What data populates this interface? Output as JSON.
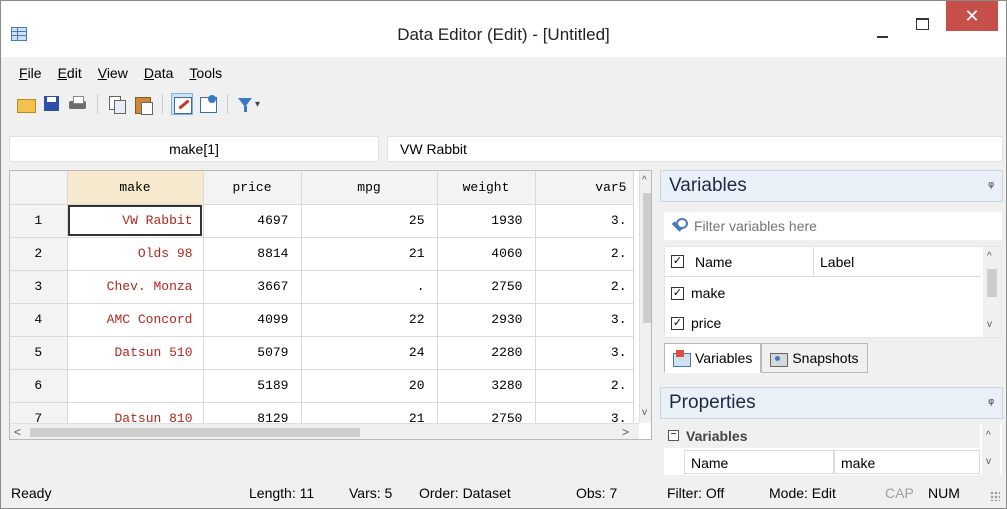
{
  "window": {
    "title": "Data Editor (Edit) - [Untitled]",
    "close_glyph": "✕"
  },
  "menu": [
    {
      "label": "File",
      "accel": "F",
      "rest": "ile"
    },
    {
      "label": "Edit",
      "accel": "E",
      "rest": "dit"
    },
    {
      "label": "View",
      "accel": "V",
      "rest": "iew"
    },
    {
      "label": "Data",
      "accel": "D",
      "rest": "ata"
    },
    {
      "label": "Tools",
      "accel": "T",
      "rest": "ools"
    }
  ],
  "toolbar": {
    "buttons": [
      "open-icon",
      "save-icon",
      "print-icon",
      "copy-icon",
      "paste-icon",
      "edit-mode-icon",
      "browse-mode-icon",
      "filter-icon"
    ],
    "filter_dropdown_glyph": "▾"
  },
  "cell_editor": {
    "reference": "make[1]",
    "value": "VW Rabbit"
  },
  "grid": {
    "columns": [
      "make",
      "price",
      "mpg",
      "weight",
      "var5"
    ],
    "rows": [
      {
        "n": "1",
        "make": "VW Rabbit",
        "price": "4697",
        "mpg": "25",
        "weight": "1930",
        "var5": "3."
      },
      {
        "n": "2",
        "make": "Olds 98",
        "price": "8814",
        "mpg": "21",
        "weight": "4060",
        "var5": "2."
      },
      {
        "n": "3",
        "make": "Chev. Monza",
        "price": "3667",
        "mpg": ".",
        "weight": "2750",
        "var5": "2."
      },
      {
        "n": "4",
        "make": "AMC Concord",
        "price": "4099",
        "mpg": "22",
        "weight": "2930",
        "var5": "3."
      },
      {
        "n": "5",
        "make": "Datsun 510",
        "price": "5079",
        "mpg": "24",
        "weight": "2280",
        "var5": "3."
      },
      {
        "n": "6",
        "make": "",
        "price": "5189",
        "mpg": "20",
        "weight": "3280",
        "var5": "2."
      },
      {
        "n": "7",
        "make": "Datsun 810",
        "price": "8129",
        "mpg": "21",
        "weight": "2750",
        "var5": "3."
      }
    ],
    "scroll_up": "^",
    "scroll_down": "v",
    "scroll_left": "<",
    "scroll_right": ">"
  },
  "variables_panel": {
    "title": "Variables",
    "pin": "ᵠ",
    "filter_placeholder": "Filter variables here",
    "header_name": "Name",
    "header_label": "Label",
    "items": [
      {
        "name": "make",
        "checked": "☑"
      },
      {
        "name": "price",
        "checked": "☑"
      }
    ],
    "check_glyph": "✓",
    "tabs": [
      {
        "label": "Variables",
        "active": true
      },
      {
        "label": "Snapshots",
        "active": false
      }
    ]
  },
  "properties_panel": {
    "title": "Properties",
    "pin": "ᵠ",
    "group_label": "Variables",
    "group_toggle": "−",
    "row_name": "Name",
    "row_value": "make"
  },
  "status": {
    "ready": "Ready",
    "length": "Length: 11",
    "vars": "Vars: 5",
    "order": "Order: Dataset",
    "obs": "Obs: 7",
    "filter": "Filter: Off",
    "mode": "Mode: Edit",
    "cap": "CAP",
    "num": "NUM"
  }
}
